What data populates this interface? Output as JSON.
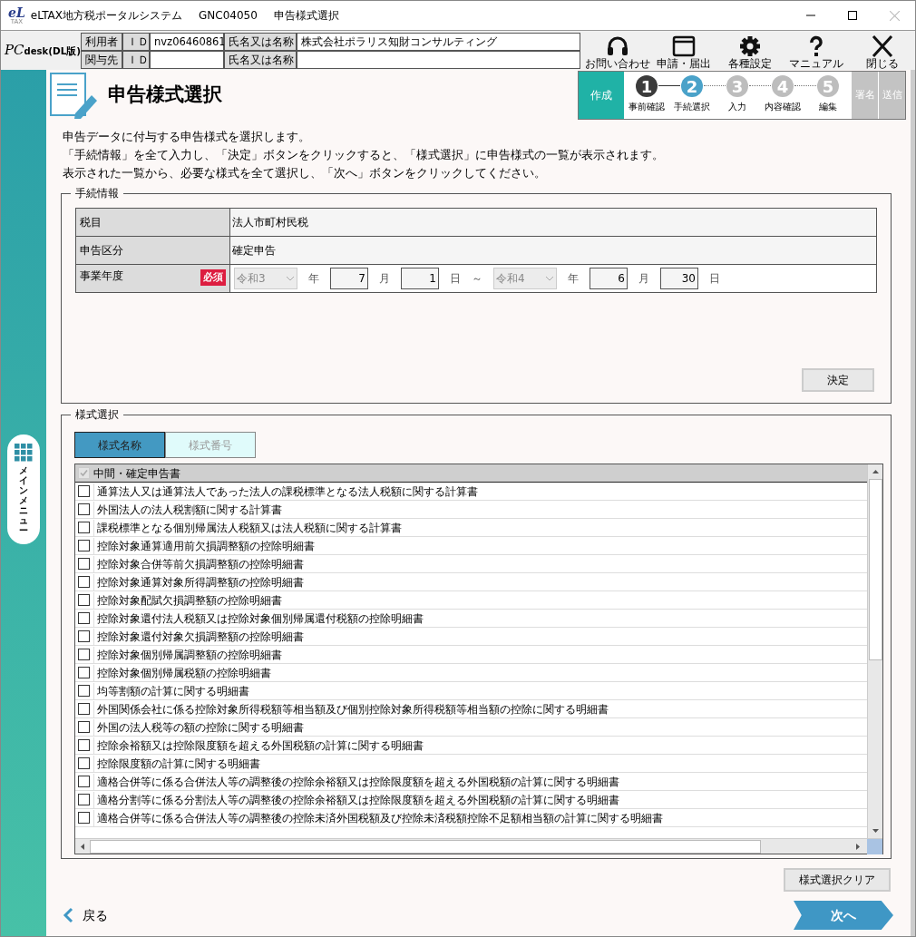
{
  "window": {
    "logo": "eL",
    "logo_sub": "TAX",
    "app": "eLTAX地方税ポータルシステム",
    "screen_id": "GNC04050",
    "screen_name": "申告様式選択"
  },
  "product": {
    "pc": "PC",
    "desk": "desk",
    "edition": "(DL版)"
  },
  "user_table": [
    {
      "label": "利用者",
      "id_label": "ＩＤ",
      "id": "nvz06460861",
      "name_label": "氏名又は名称",
      "name": "株式会社ポラリス知財コンサルティング"
    },
    {
      "label": "関与先",
      "id_label": "ＩＤ",
      "name_label": "氏名又は名称"
    }
  ],
  "toolbar": [
    "お問い合わせ",
    "申請・届出",
    "各種設定",
    "マニュアル",
    "閉じる"
  ],
  "side_menu": {
    "label": "メインメニュー"
  },
  "page_title": "申告様式選択",
  "progress": {
    "create": "作成",
    "steps": [
      {
        "number": "1",
        "label": "事前確認",
        "completed": true,
        "selected": false
      },
      {
        "number": "2",
        "label": "手続選択",
        "completed": false,
        "selected": true
      },
      {
        "number": "3",
        "label": "入力",
        "completed": false,
        "selected": false
      },
      {
        "number": "4",
        "label": "内容確認",
        "completed": false,
        "selected": false
      },
      {
        "number": "5",
        "label": "編集",
        "completed": false,
        "selected": false
      }
    ],
    "after": [
      "署名",
      "送信"
    ]
  },
  "description": [
    "申告データに付与する申告様式を選択します。",
    "「手続情報」を全て入力し、「決定」ボタンをクリックすると、「様式選択」に申告様式の一覧が表示されます。",
    "表示された一覧から、必要な様式を全て選択し、「次へ」ボタンをクリックしてください。"
  ],
  "procedure": {
    "legend": "手続情報",
    "rows": [
      {
        "label": "税目",
        "value": "法人市町村民税"
      },
      {
        "label": "申告区分",
        "value": "確定申告"
      }
    ],
    "period": {
      "label": "事業年度",
      "required": "必須",
      "start_era": "令和3",
      "start_year_unit": "年",
      "start_month": "7",
      "month_unit": "月",
      "start_day": "1",
      "day_unit": "日",
      "separator": "～",
      "end_era": "令和4",
      "end_year_unit": "年",
      "end_month": "6",
      "end_month_unit": "月",
      "end_day": "30",
      "end_day_unit": "日"
    },
    "decide_button": "決定"
  },
  "form_select": {
    "legend": "様式選択",
    "tabs": [
      {
        "label": "様式名称",
        "selected": true
      },
      {
        "label": "様式番号",
        "selected": false
      }
    ],
    "group": {
      "label": "中間・確定申告書",
      "checked": true,
      "disabled": true
    },
    "items": [
      {
        "label": "通算法人又は通算法人であった法人の課税標準となる法人税額に関する計算書",
        "checked": false
      },
      {
        "label": "外国法人の法人税割額に関する計算書",
        "checked": false
      },
      {
        "label": "課税標準となる個別帰属法人税額又は法人税額に関する計算書",
        "checked": false
      },
      {
        "label": "控除対象通算適用前欠損調整額の控除明細書",
        "checked": false
      },
      {
        "label": "控除対象合併等前欠損調整額の控除明細書",
        "checked": false
      },
      {
        "label": "控除対象通算対象所得調整額の控除明細書",
        "checked": false
      },
      {
        "label": "控除対象配賦欠損調整額の控除明細書",
        "checked": false
      },
      {
        "label": "控除対象還付法人税額又は控除対象個別帰属還付税額の控除明細書",
        "checked": false
      },
      {
        "label": "控除対象還付対象欠損調整額の控除明細書",
        "checked": false
      },
      {
        "label": "控除対象個別帰属調整額の控除明細書",
        "checked": false
      },
      {
        "label": "控除対象個別帰属税額の控除明細書",
        "checked": false
      },
      {
        "label": "均等割額の計算に関する明細書",
        "checked": false
      },
      {
        "label": "外国関係会社に係る控除対象所得税額等相当額及び個別控除対象所得税額等相当額の控除に関する明細書",
        "checked": false
      },
      {
        "label": "外国の法人税等の額の控除に関する明細書",
        "checked": false
      },
      {
        "label": "控除余裕額又は控除限度額を超える外国税額の計算に関する明細書",
        "checked": false
      },
      {
        "label": "控除限度額の計算に関する明細書",
        "checked": false
      },
      {
        "label": "適格合併等に係る合併法人等の調整後の控除余裕額又は控除限度額を超える外国税額の計算に関する明細書",
        "checked": false
      },
      {
        "label": "適格分割等に係る分割法人等の調整後の控除余裕額又は控除限度額を超える外国税額の計算に関する明細書",
        "checked": false
      },
      {
        "label": "適格合併等に係る合併法人等の調整後の控除未済外国税額及び控除未済税額控除不足額相当額の計算に関する明細書",
        "checked": false
      }
    ],
    "clear_button": "様式選択クリア"
  },
  "nav": {
    "back": "戻る",
    "next": "次へ"
  }
}
